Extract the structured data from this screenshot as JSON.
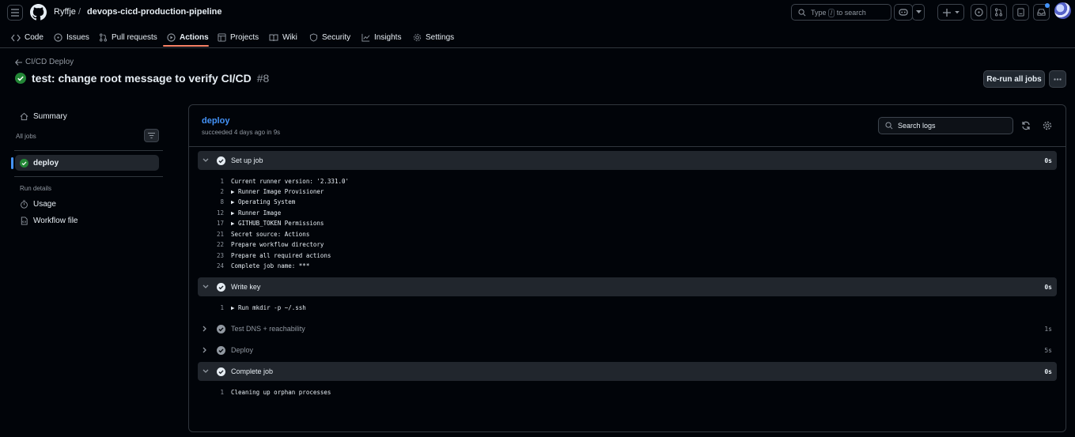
{
  "header": {
    "owner": "Ryffje",
    "separator": "/",
    "repo": "devops-cicd-production-pipeline",
    "search_placeholder_pre": "Type",
    "search_key": "/",
    "search_placeholder_post": "to search"
  },
  "nav": {
    "tabs": [
      {
        "label": "Code",
        "icon": "code-icon"
      },
      {
        "label": "Issues",
        "icon": "issue-icon"
      },
      {
        "label": "Pull requests",
        "icon": "pull-request-icon"
      },
      {
        "label": "Actions",
        "icon": "play-icon",
        "active": true
      },
      {
        "label": "Projects",
        "icon": "table-icon"
      },
      {
        "label": "Wiki",
        "icon": "book-icon"
      },
      {
        "label": "Security",
        "icon": "shield-icon"
      },
      {
        "label": "Insights",
        "icon": "graph-icon"
      },
      {
        "label": "Settings",
        "icon": "gear-icon"
      }
    ]
  },
  "run": {
    "workflow": "CI/CD Deploy",
    "title": "test: change root message to verify CI/CD",
    "number": "#8",
    "rerun_label": "Re-run all jobs",
    "status_color": "#238636"
  },
  "sidebar": {
    "summary": "Summary",
    "all_jobs": "All jobs",
    "job": "deploy",
    "run_details": "Run details",
    "usage": "Usage",
    "workflow_file": "Workflow file"
  },
  "job": {
    "name": "deploy",
    "status": "succeeded 4 days ago in 9s",
    "search_placeholder": "Search logs",
    "steps": [
      {
        "name": "Set up job",
        "duration": "0s",
        "expanded": true,
        "lines": [
          {
            "n": "1",
            "t": "Current runner version: '2.331.0'"
          },
          {
            "n": "2",
            "t": "▶ Runner Image Provisioner"
          },
          {
            "n": "8",
            "t": "▶ Operating System"
          },
          {
            "n": "12",
            "t": "▶ Runner Image"
          },
          {
            "n": "17",
            "t": "▶ GITHUB_TOKEN Permissions"
          },
          {
            "n": "21",
            "t": "Secret source: Actions"
          },
          {
            "n": "22",
            "t": "Prepare workflow directory"
          },
          {
            "n": "23",
            "t": "Prepare all required actions"
          },
          {
            "n": "24",
            "t": "Complete job name: ***"
          }
        ]
      },
      {
        "name": "Write key",
        "duration": "0s",
        "expanded": true,
        "lines": [
          {
            "n": "1",
            "t": "▶ Run mkdir -p ~/.ssh"
          }
        ]
      },
      {
        "name": "Test DNS + reachability",
        "duration": "1s",
        "expanded": false,
        "lines": []
      },
      {
        "name": "Deploy",
        "duration": "5s",
        "expanded": false,
        "lines": []
      },
      {
        "name": "Complete job",
        "duration": "0s",
        "expanded": true,
        "lines": [
          {
            "n": "1",
            "t": "Cleaning up orphan processes"
          }
        ]
      }
    ]
  }
}
